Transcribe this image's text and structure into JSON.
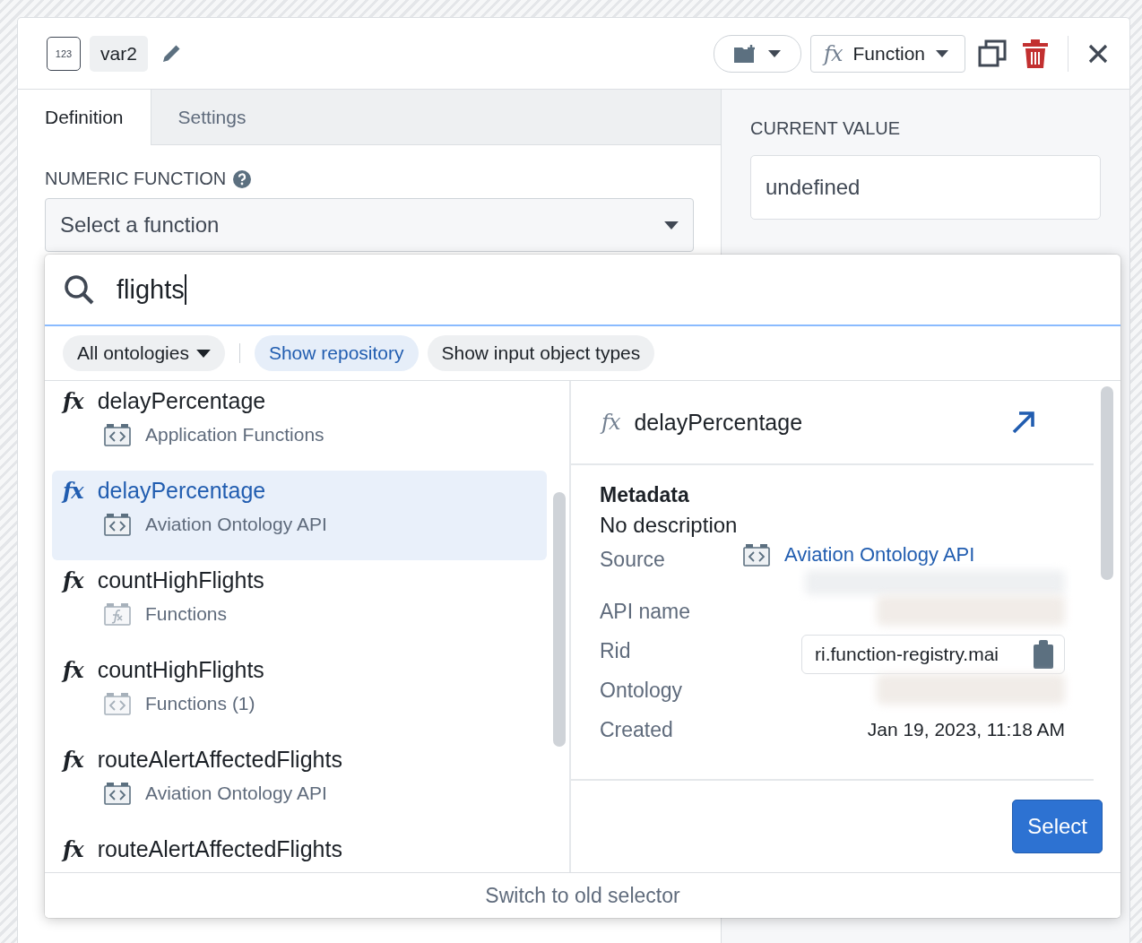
{
  "header": {
    "type_badge": "123",
    "variable_name": "var2",
    "type_dropdown": {
      "icon_text": "fx",
      "label": "Function"
    }
  },
  "tabs": [
    {
      "label": "Definition",
      "selected": true
    },
    {
      "label": "Settings",
      "selected": false
    }
  ],
  "field": {
    "label": "NUMERIC FUNCTION",
    "placeholder": "Select a function"
  },
  "current_value": {
    "label": "CURRENT VALUE",
    "value": "undefined"
  },
  "popover": {
    "search": {
      "value": "flights"
    },
    "filters": [
      {
        "label": "All ontologies",
        "kind": "dropdown",
        "selected": false
      },
      {
        "label": "Show repository",
        "kind": "toggle",
        "selected": true
      },
      {
        "label": "Show input object types",
        "kind": "toggle",
        "selected": false
      }
    ],
    "results": [
      {
        "icon_text": "fx",
        "name": "delayPercentage",
        "source": "Application Functions",
        "kind": "code",
        "faded": false,
        "selected": false
      },
      {
        "icon_text": "fx",
        "name": "delayPercentage",
        "source": "Aviation Ontology API",
        "kind": "code",
        "faded": false,
        "selected": true
      },
      {
        "icon_text": "fx",
        "name": "countHighFlights",
        "source": "Functions",
        "kind": "function",
        "faded": true,
        "selected": false
      },
      {
        "icon_text": "fx",
        "name": "countHighFlights",
        "source": "Functions (1)",
        "kind": "code",
        "faded": true,
        "selected": false
      },
      {
        "icon_text": "fx",
        "name": "routeAlertAffectedFlights",
        "source": "Aviation Ontology API",
        "kind": "code",
        "faded": false,
        "selected": false
      },
      {
        "icon_text": "fx",
        "name": "routeAlertAffectedFlights",
        "selected": false
      }
    ],
    "detail": {
      "icon_text": "fx",
      "title": "delayPercentage",
      "section": "Metadata",
      "description": "No description",
      "rows": [
        {
          "label": "Source",
          "kind": "link",
          "value": "Aviation Ontology API",
          "redacted": true
        },
        {
          "label": "API name",
          "kind": "redacted"
        },
        {
          "label": "Rid",
          "kind": "copy",
          "value": "ri.function-registry.mai"
        },
        {
          "label": "Ontology",
          "kind": "redacted"
        },
        {
          "label": "Created",
          "kind": "text",
          "value": "Jan 19, 2023, 11:18 AM"
        }
      ],
      "button": "Select"
    },
    "footer": "Switch to old selector"
  }
}
